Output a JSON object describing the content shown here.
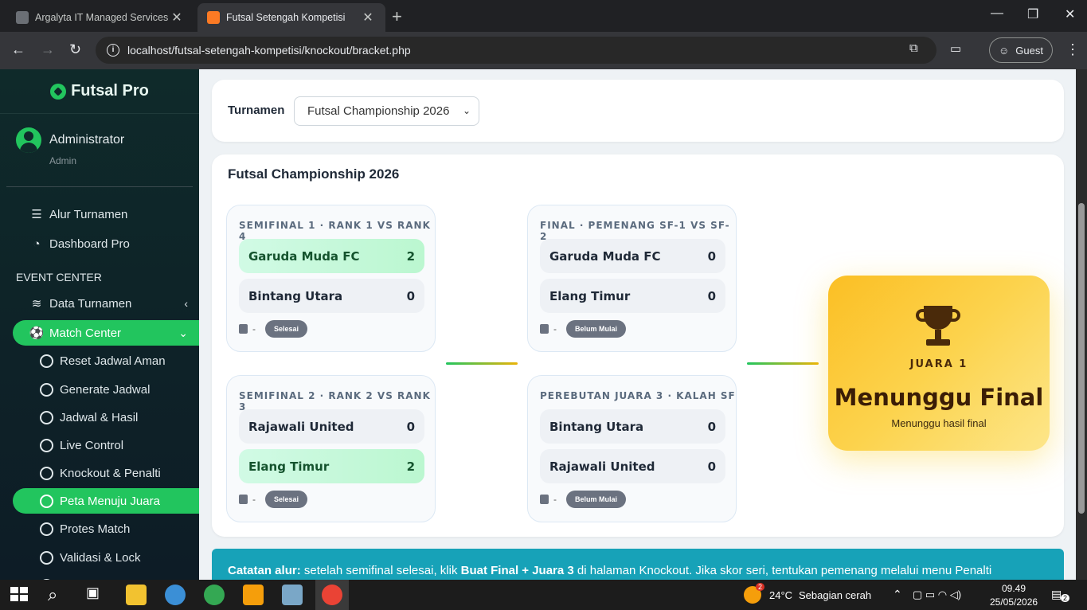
{
  "browser": {
    "tabs": [
      {
        "title": "Argalyta IT Managed Services &"
      },
      {
        "title": "Futsal Setengah Kompetisi"
      }
    ],
    "url": "localhost/futsal-setengah-kompetisi/knockout/bracket.php",
    "guest_label": "Guest"
  },
  "sidebar": {
    "brand": "Futsal Pro",
    "user_name": "Administrator",
    "user_role": "Admin",
    "items": [
      {
        "label": "Alur Turnamen"
      },
      {
        "label": "Dashboard Pro"
      }
    ],
    "section": "EVENT CENTER",
    "data_turnamen": "Data Turnamen",
    "match_center": "Match Center",
    "subitems": [
      {
        "label": "Reset Jadwal Aman"
      },
      {
        "label": "Generate Jadwal"
      },
      {
        "label": "Jadwal & Hasil"
      },
      {
        "label": "Live Control"
      },
      {
        "label": "Knockout & Penalti"
      },
      {
        "label": "Peta Menuju Juara"
      },
      {
        "label": "Protes Match"
      },
      {
        "label": "Validasi & Lock"
      }
    ]
  },
  "filter": {
    "label": "Turnamen",
    "selected": "Futsal Championship 2026"
  },
  "bracket": {
    "title": "Futsal Championship 2026",
    "matches": [
      {
        "header": "SEMIFINAL 1 · RANK 1 VS RANK 4",
        "teams": [
          {
            "name": "Garuda Muda FC",
            "score": "2"
          },
          {
            "name": "Bintang Utara",
            "score": "0"
          }
        ],
        "date": "-",
        "status": "Selesai"
      },
      {
        "header": "SEMIFINAL 2 · RANK 2 VS RANK 3",
        "teams": [
          {
            "name": "Rajawali United",
            "score": "0"
          },
          {
            "name": "Elang Timur",
            "score": "2"
          }
        ],
        "date": "-",
        "status": "Selesai"
      },
      {
        "header": "FINAL · PEMENANG SF-1 VS SF-2",
        "teams": [
          {
            "name": "Garuda Muda FC",
            "score": "0"
          },
          {
            "name": "Elang Timur",
            "score": "0"
          }
        ],
        "date": "-",
        "status": "Belum Mulai"
      },
      {
        "header": "PEREBUTAN JUARA 3 · KALAH SF",
        "teams": [
          {
            "name": "Bintang Utara",
            "score": "0"
          },
          {
            "name": "Rajawali United",
            "score": "0"
          }
        ],
        "date": "-",
        "status": "Belum Mulai"
      }
    ],
    "champion": {
      "label": "JUARA 1",
      "name": "Menunggu Final",
      "note": "Menunggu hasil final"
    }
  },
  "note": {
    "strong1": "Catatan alur:",
    "text1": " setelah semifinal selesai, klik ",
    "strong2": "Buat Final + Juara 3",
    "text2": " di halaman Knockout. Jika skor seri, tentukan pemenang melalui menu Penalti"
  },
  "taskbar": {
    "weather_temp": "24°C",
    "weather_desc": "Sebagian cerah",
    "weather_badge": "2",
    "time": "09.49",
    "date": "25/05/2026",
    "notif": "2"
  }
}
